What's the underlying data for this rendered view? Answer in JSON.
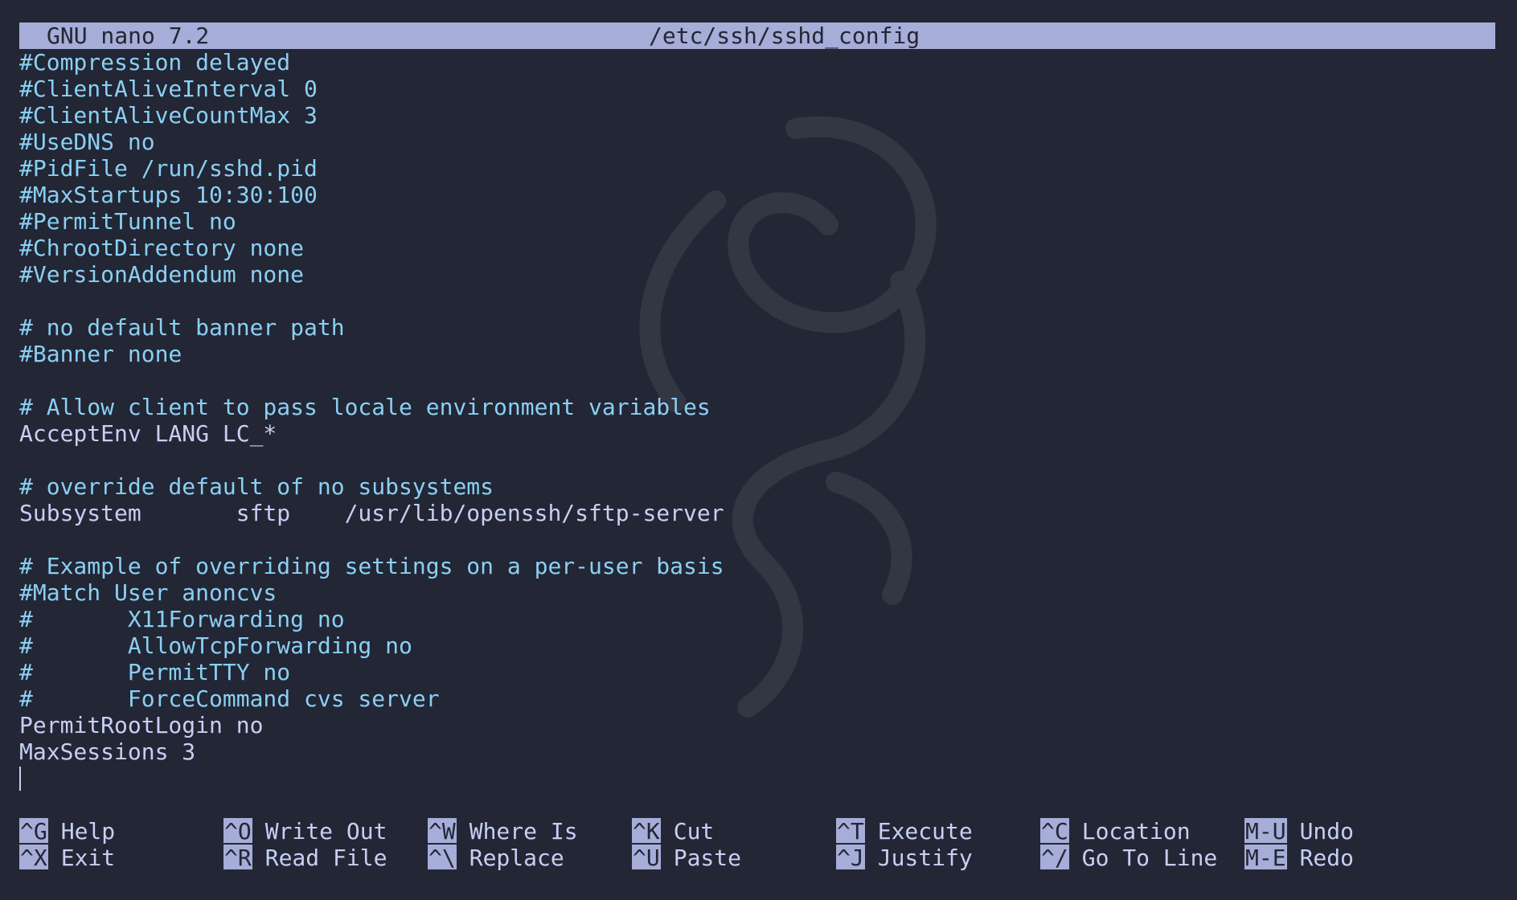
{
  "titlebar": {
    "app": "GNU nano 7.2",
    "file": "/etc/ssh/sshd_config"
  },
  "lines": [
    {
      "text": "#Compression delayed",
      "type": "comment"
    },
    {
      "text": "#ClientAliveInterval 0",
      "type": "comment"
    },
    {
      "text": "#ClientAliveCountMax 3",
      "type": "comment"
    },
    {
      "text": "#UseDNS no",
      "type": "comment"
    },
    {
      "text": "#PidFile /run/sshd.pid",
      "type": "comment"
    },
    {
      "text": "#MaxStartups 10:30:100",
      "type": "comment"
    },
    {
      "text": "#PermitTunnel no",
      "type": "comment"
    },
    {
      "text": "#ChrootDirectory none",
      "type": "comment"
    },
    {
      "text": "#VersionAddendum none",
      "type": "comment"
    },
    {
      "text": "",
      "type": "blank"
    },
    {
      "text": "# no default banner path",
      "type": "comment"
    },
    {
      "text": "#Banner none",
      "type": "comment"
    },
    {
      "text": "",
      "type": "blank"
    },
    {
      "text": "# Allow client to pass locale environment variables",
      "type": "comment"
    },
    {
      "text": "AcceptEnv LANG LC_*",
      "type": "code"
    },
    {
      "text": "",
      "type": "blank"
    },
    {
      "text": "# override default of no subsystems",
      "type": "comment"
    },
    {
      "text": "Subsystem       sftp    /usr/lib/openssh/sftp-server",
      "type": "code"
    },
    {
      "text": "",
      "type": "blank"
    },
    {
      "text": "# Example of overriding settings on a per-user basis",
      "type": "comment"
    },
    {
      "text": "#Match User anoncvs",
      "type": "comment"
    },
    {
      "text": "#       X11Forwarding no",
      "type": "comment"
    },
    {
      "text": "#       AllowTcpForwarding no",
      "type": "comment"
    },
    {
      "text": "#       PermitTTY no",
      "type": "comment"
    },
    {
      "text": "#       ForceCommand cvs server",
      "type": "comment"
    },
    {
      "text": "PermitRootLogin no",
      "type": "code"
    },
    {
      "text": "MaxSessions 3",
      "type": "code"
    },
    {
      "text": "",
      "type": "cursor"
    }
  ],
  "shortcuts": [
    [
      {
        "key": "^G",
        "label": "Help"
      },
      {
        "key": "^O",
        "label": "Write Out"
      },
      {
        "key": "^W",
        "label": "Where Is"
      },
      {
        "key": "^K",
        "label": "Cut"
      },
      {
        "key": "^T",
        "label": "Execute"
      },
      {
        "key": "^C",
        "label": "Location"
      },
      {
        "key": "M-U",
        "label": "Undo"
      }
    ],
    [
      {
        "key": "^X",
        "label": "Exit"
      },
      {
        "key": "^R",
        "label": "Read File"
      },
      {
        "key": "^\\",
        "label": "Replace"
      },
      {
        "key": "^U",
        "label": "Paste"
      },
      {
        "key": "^J",
        "label": "Justify"
      },
      {
        "key": "^/",
        "label": "Go To Line"
      },
      {
        "key": "M-E",
        "label": "Redo"
      }
    ]
  ],
  "colors": {
    "background": "#232634",
    "comment": "#8ad0f4",
    "text": "#c6d0f5",
    "bar": "#a6add8"
  }
}
